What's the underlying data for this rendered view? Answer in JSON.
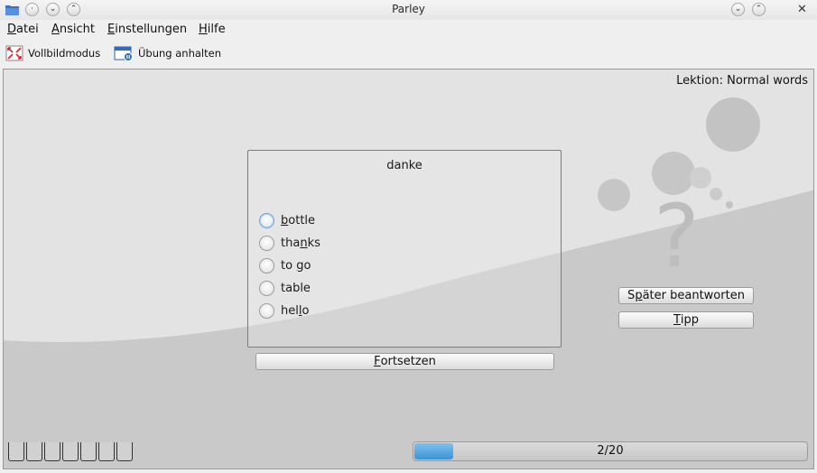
{
  "window": {
    "title": "Parley"
  },
  "menu": [
    {
      "label_pre": "",
      "label_key": "D",
      "label_post": "atei"
    },
    {
      "label_pre": "",
      "label_key": "A",
      "label_post": "nsicht"
    },
    {
      "label_pre": "",
      "label_key": "E",
      "label_post": "instellungen"
    },
    {
      "label_pre": "",
      "label_key": "H",
      "label_post": "ilfe"
    }
  ],
  "toolbar": {
    "fullscreen_label": "Vollbildmodus",
    "pause_label": "Übung anhalten"
  },
  "practice": {
    "lesson_label": "Lektion: Normal words",
    "question": "danke",
    "options": [
      {
        "key": "b",
        "rest_pre": "",
        "rest_post": "ottle",
        "focused": true
      },
      {
        "key": "n",
        "rest_pre": "tha",
        "rest_post": "ks",
        "focused": false
      },
      {
        "key": "g",
        "rest_pre": "to ",
        "rest_post": "o",
        "focused": false
      },
      {
        "key": "",
        "rest_pre": "table",
        "rest_post": "",
        "focused": false
      },
      {
        "key": "l",
        "rest_pre": "hel",
        "rest_post": "o",
        "focused": false
      }
    ],
    "continue_button": {
      "key": "F",
      "rest": "ortsetzen"
    },
    "skip_button": {
      "pre": "S",
      "key": "p",
      "rest": "äter beantworten"
    },
    "hint_button": {
      "key": "T",
      "rest": "ipp"
    },
    "progress": {
      "text": "2/20",
      "current": 2,
      "total": 20
    },
    "box_count": 7
  },
  "colors": {
    "progress_fill": "#3c92d6",
    "focus_ring": "#6fa7d6",
    "folder_icon": "#3a6fc1"
  }
}
